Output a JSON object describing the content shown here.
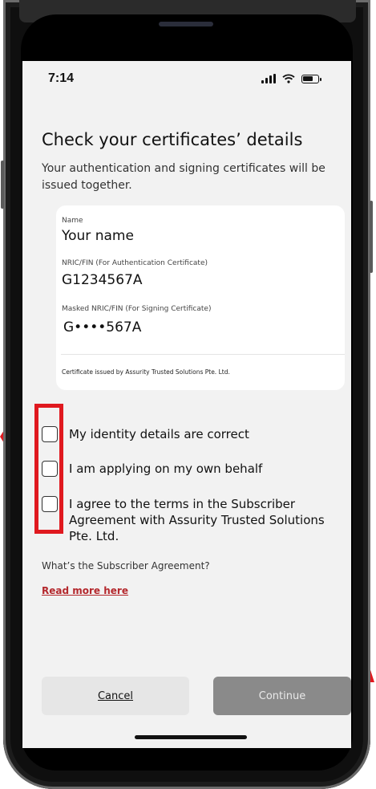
{
  "status_bar": {
    "time": "7:14"
  },
  "page": {
    "title": "Check your certificates’ details",
    "subtitle": "Your authentication and signing certificates will be issued together."
  },
  "certificate_card": {
    "name_label": "Name",
    "name_value": "Your name",
    "nric_label": "NRIC/FIN (For Authentication Certificate)",
    "nric_value": "G1234567A",
    "masked_label": "Masked NRIC/FIN (For Signing Certificate)",
    "masked_value": "G••••567A",
    "issuer_text": "Certificate issued by Assurity Trusted Solutions Pte. Ltd."
  },
  "checkboxes": [
    {
      "label": "My identity details are correct",
      "checked": false
    },
    {
      "label": "I am applying on my own behalf",
      "checked": false
    },
    {
      "label": "I agree to the terms in the Subscriber Agreement with Assurity Trusted Solutions Pte. Ltd.",
      "checked": false
    }
  ],
  "agreement": {
    "question": "What’s the Subscriber Agreement?",
    "link_text": "Read more here"
  },
  "buttons": {
    "cancel": "Cancel",
    "continue": "Continue"
  },
  "colors": {
    "accent_red": "#b4282d",
    "annotation_red": "#e0191f",
    "continue_disabled": "#8a8a8a"
  }
}
